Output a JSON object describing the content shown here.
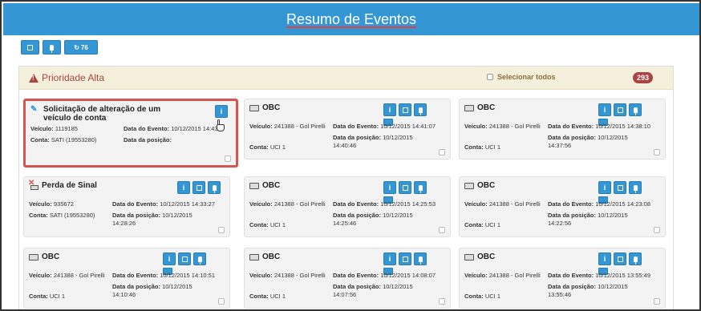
{
  "header": {
    "title": "Resumo de Eventos"
  },
  "toolbar": {
    "refresh_count": "76"
  },
  "priority": {
    "title": "Prioridade Alta",
    "select_all": "Selecionar todos",
    "count": "293"
  },
  "labels": {
    "veiculo": "Veículo:",
    "conta": "Conta:",
    "data_evento": "Data do Evento:",
    "data_posicao": "Data da posição:"
  },
  "cards": [
    {
      "title": "Solicitação de alteração de um veículo de conta",
      "icon": "request-icon",
      "veiculo": "1119185",
      "conta": "SATI (19553280)",
      "data_evento": "10/12/2015 14:43:",
      "data_posicao": ""
    },
    {
      "title": "OBC",
      "icon": "truck-icon",
      "veiculo": "241388 - Gol Pirelli",
      "conta": "UCI 1",
      "data_evento": "10/12/2015 14:41:07",
      "data_posicao": "10/12/2015 14:40:46"
    },
    {
      "title": "OBC",
      "icon": "truck-icon",
      "veiculo": "241388 - Gol Pirelli",
      "conta": "UCI 1",
      "data_evento": "10/12/2015 14:38:10",
      "data_posicao": "10/12/2015 14:37:56"
    },
    {
      "title": "Perda de Sinal",
      "icon": "signal-lost-icon",
      "veiculo": "935672",
      "conta": "SATI (19553280)",
      "data_evento": "10/12/2015 14:33:27",
      "data_posicao": "10/12/2015 14:28:26"
    },
    {
      "title": "OBC",
      "icon": "truck-icon",
      "veiculo": "241388 - Gol Pirelli",
      "conta": "UCI 1",
      "data_evento": "10/12/2015 14:25:53",
      "data_posicao": "10/12/2015 14:25:46"
    },
    {
      "title": "OBC",
      "icon": "truck-icon",
      "veiculo": "241388 - Gol Pirelli",
      "conta": "UCI 1",
      "data_evento": "10/12/2015 14:23:08",
      "data_posicao": "10/12/2015 14:22:56"
    },
    {
      "title": "OBC",
      "icon": "truck-icon",
      "veiculo": "241388 - Gol Pirelli",
      "conta": "UCI 1",
      "data_evento": "10/12/2015 14:10:51",
      "data_posicao": "10/12/2015 14:10:46"
    },
    {
      "title": "OBC",
      "icon": "truck-icon",
      "veiculo": "241388 - Gol Pirelli",
      "conta": "UCI 1",
      "data_evento": "10/12/2015 14:08:07",
      "data_posicao": "10/12/2015 14:07:56"
    },
    {
      "title": "OBC",
      "icon": "truck-icon",
      "veiculo": "241388 - Gol Pirelli",
      "conta": "UCI 1",
      "data_evento": "10/12/2015 13:55:49",
      "data_posicao": "10/12/2015 13:55:46"
    }
  ]
}
